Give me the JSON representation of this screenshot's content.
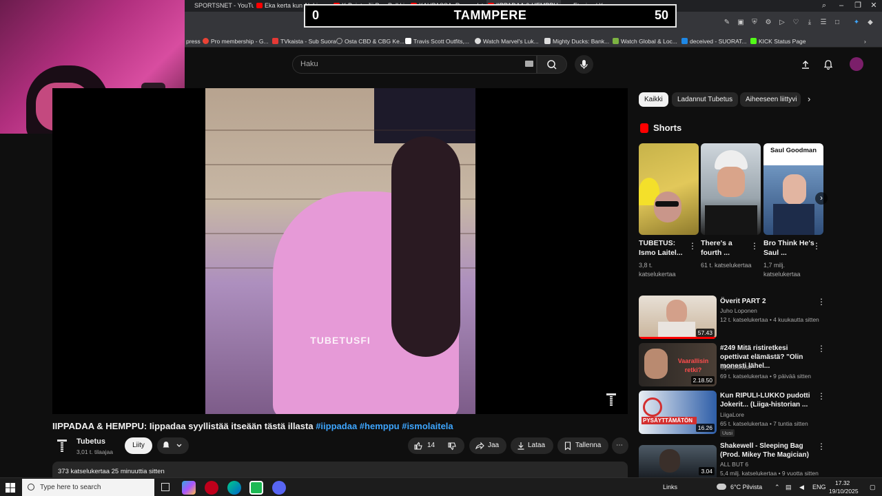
{
  "browser": {
    "tabs": [
      {
        "title": "SPORTSNET - YouTube"
      },
      {
        "title": "Eka kerta kun Ak Linnam..."
      },
      {
        "title": "X-Pojat - Jii Pee Pull kin..."
      },
      {
        "title": "KAUPASSA: Ruoonulsto..."
      },
      {
        "title": "IIPPADAA & HEMPPU..."
      },
      {
        "title": "Etusivu / X"
      }
    ],
    "bookmarks": [
      {
        "label": "press",
        "color": "#888"
      },
      {
        "label": "Pro membership - G...",
        "color": "#ea4335"
      },
      {
        "label": "TVkaista - Sub Suora",
        "color": "#e53935"
      },
      {
        "label": "Osta CBD & CBG Ke...",
        "color": "#aaa"
      },
      {
        "label": "Travis Scott Outfits,...",
        "color": "#fff"
      },
      {
        "label": "Watch Marvel's Luk...",
        "color": "#ddd"
      },
      {
        "label": "Mighty Ducks: Bank...",
        "color": "#ddd"
      },
      {
        "label": "Watch Global & Loc...",
        "color": "#7cb342"
      },
      {
        "label": "deceived - SUORAT...",
        "color": "#1e88e5"
      },
      {
        "label": "KICK Status Page",
        "color": "#111"
      }
    ]
  },
  "scoreboard": {
    "left": "0",
    "team": "TAMMPERE",
    "right": "50"
  },
  "masthead": {
    "search_placeholder": "Haku"
  },
  "video": {
    "watermark": "TUBETUSFI",
    "title_main": "IIPPADAA & HEMPPU: Iippadaa syyllistää itseään tästä illasta",
    "hashtags": [
      "#iippadaa",
      "#hemppu",
      "#ismolaitela"
    ],
    "channel": "Tubetus",
    "subscribers": "3,01 t. tilaajaa",
    "join_label": "Liity",
    "likes": "14",
    "share_label": "Jaa",
    "download_label": "Lataa",
    "save_label": "Tallenna",
    "description_meta": "373 katselukertaa  25 minuuttia sitten"
  },
  "chips": [
    {
      "label": "Kaikki",
      "active": true
    },
    {
      "label": "Ladannut Tubetus",
      "active": false
    },
    {
      "label": "Aiheeseen liittyvi",
      "active": false
    }
  ],
  "shorts": {
    "heading": "Shorts",
    "items": [
      {
        "title": "TUBETUS: Ismo Laitel...",
        "views": "3,8 t. katselukertaa"
      },
      {
        "title": "There's a fourth ...",
        "views": "61 t. katselukertaa"
      },
      {
        "title": "Bro Think He's Saul ...",
        "views": "1,7 milj. katselukertaa",
        "thumb_text": "Saul Goodman"
      }
    ]
  },
  "recommendations": [
    {
      "title": "Överit PART 2",
      "channel": "Juho Loponen",
      "meta": "12 t. katselukertaa • 4 kuukautta sitten",
      "duration": "57.43"
    },
    {
      "title": "#249 Mitä ristiretkesi opettivat elämästä? \"Olin monesti lähel...",
      "channel": "Sijoituskästi",
      "meta": "69 t. katselukertaa • 9 päivää sitten",
      "duration": "2.18.50",
      "thumb_text": "Vaarallisin retki?"
    },
    {
      "title": "Kun RIPULI-LUKKO pudotti Jokerit... (Liiga-historian ...",
      "channel": "LiigaLore",
      "meta": "65 t. katselukertaa • 7 tuntia sitten",
      "duration": "16.26",
      "badge": "Uusi",
      "thumb_text": "PYSÄYTTÄMÄTÖN"
    },
    {
      "title": "Shakewell - Sleeping Bag (Prod. Mikey The Magician)",
      "channel": "ALL BUT 6",
      "meta": "5,4 milj. katselukertaa • 9 vuotta sitten",
      "duration": "3.04"
    }
  ],
  "taskbar": {
    "search_placeholder": "Type here to search",
    "links": "Links",
    "weather": "6°C Pilvista",
    "lang": "ENG",
    "time": "17.32",
    "date": "19/10/2025"
  }
}
